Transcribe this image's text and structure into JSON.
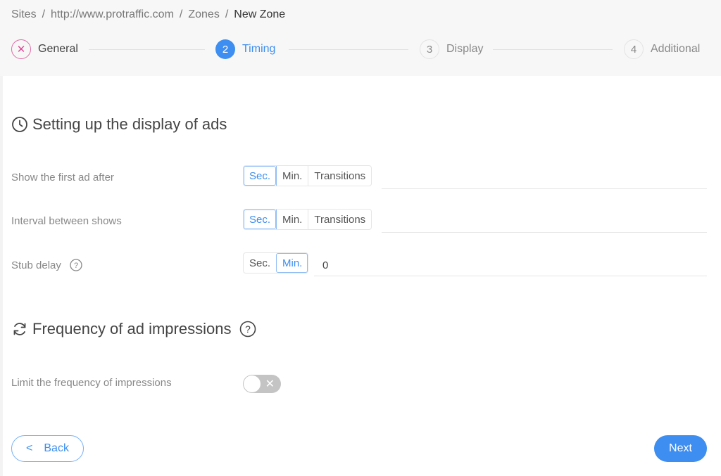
{
  "breadcrumb": {
    "items": [
      "Sites",
      "http://www.protraffic.com",
      "Zones"
    ],
    "current": "New Zone",
    "separator": "/"
  },
  "steps": [
    {
      "marker": "✕",
      "label": "General",
      "state": "error"
    },
    {
      "marker": "2",
      "label": "Timing",
      "state": "active"
    },
    {
      "marker": "3",
      "label": "Display",
      "state": "pending"
    },
    {
      "marker": "4",
      "label": "Additional",
      "state": "pending"
    }
  ],
  "display_section": {
    "title": "Setting up the display of ads",
    "icon": "clock-icon",
    "rows": [
      {
        "label": "Show the first ad after",
        "units": [
          "Sec.",
          "Min.",
          "Transitions"
        ],
        "selected": "Sec.",
        "value": ""
      },
      {
        "label": "Interval between shows",
        "units": [
          "Sec.",
          "Min.",
          "Transitions"
        ],
        "selected": "Sec.",
        "value": ""
      },
      {
        "label": "Stub delay",
        "units": [
          "Sec.",
          "Min."
        ],
        "selected": "Min.",
        "value": "0",
        "help": true
      }
    ]
  },
  "frequency_section": {
    "title": "Frequency of ad impressions",
    "icon": "refresh-icon",
    "limit_label": "Limit the frequency of impressions",
    "limit_enabled": false,
    "toggle_off_glyph": "✕"
  },
  "footer": {
    "back_label": "Back",
    "back_glyph": "<",
    "next_label": "Next"
  },
  "colors": {
    "accent": "#3d8ef0",
    "error": "#e0489a",
    "toggle_off": "#c4c4c4"
  }
}
